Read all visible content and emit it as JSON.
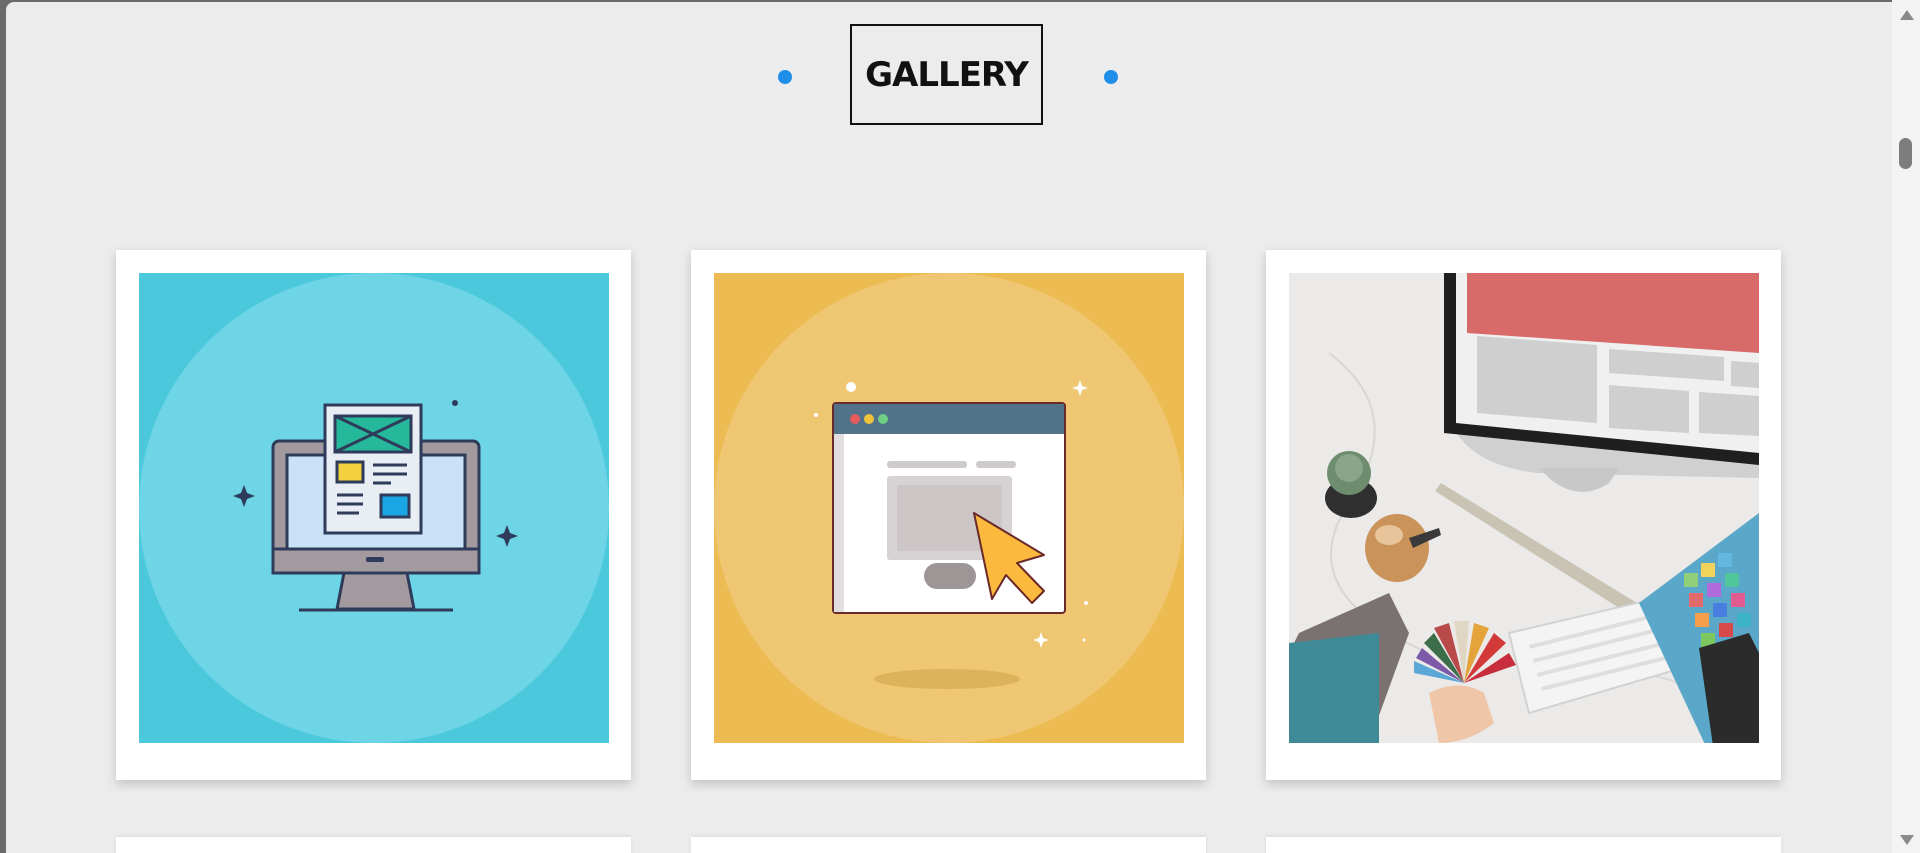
{
  "header": {
    "title": "GALLERY"
  },
  "gallery": {
    "items": [
      {
        "icon": "web-page-monitor-illustration",
        "background": "#4cc8dd"
      },
      {
        "icon": "browser-window-cursor-illustration",
        "background": "#ecbb52"
      },
      {
        "icon": "designer-desk-photo",
        "background": "#e8e8e8"
      }
    ]
  },
  "colors": {
    "accent": "#1e8ee8",
    "page_background": "#ececec"
  }
}
